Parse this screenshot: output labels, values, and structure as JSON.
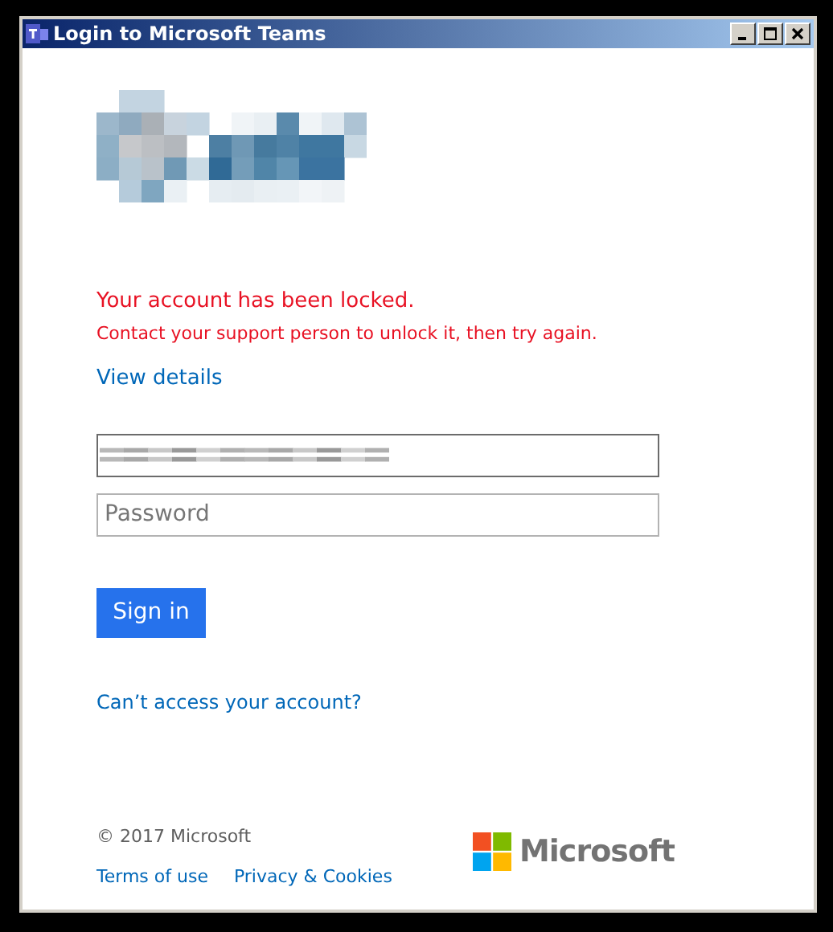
{
  "window": {
    "title": "Login to Microsoft Teams"
  },
  "error": {
    "title": "Your account has been locked.",
    "message": "Contact your support person to unlock it, then try again."
  },
  "details_link": "View details",
  "fields": [
    {
      "kind": "redacted",
      "focused": true
    },
    {
      "kind": "password",
      "placeholder": "Password",
      "focused": false
    }
  ],
  "sign_in_button": "Sign in",
  "help_link": "Can’t access your account?",
  "footer": {
    "copyright": "© 2017 Microsoft",
    "links": [
      "Terms of use",
      "Privacy & Cookies"
    ],
    "brand": "Microsoft"
  }
}
